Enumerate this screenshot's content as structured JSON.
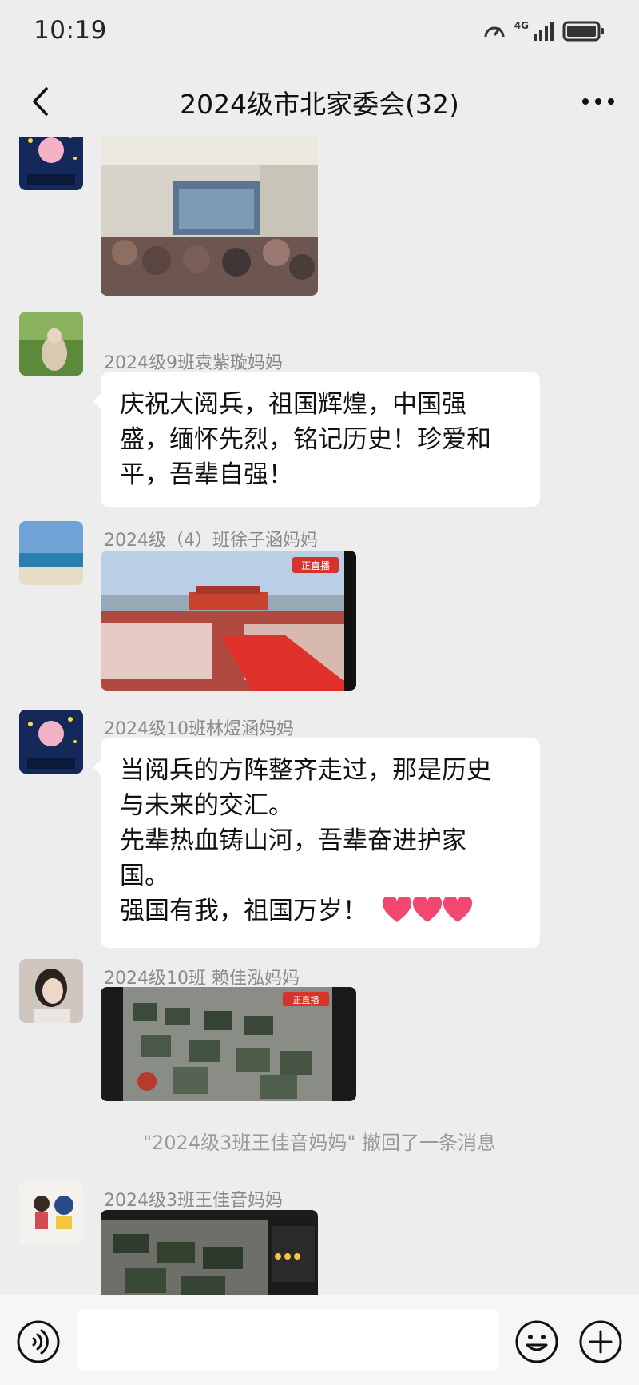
{
  "status": {
    "time": "10:19",
    "network": "4G"
  },
  "nav": {
    "title": "2024级市北家委会(32)"
  },
  "messages": [
    {
      "sender": "2024级9班袁紫璇妈妈",
      "lines": [
        "庆祝大阅兵，祖国辉煌，中国强",
        "盛，缅怀先烈，铭记历史！珍爱和",
        "平，吾辈自强！"
      ]
    },
    {
      "sender": "2024级（4）班徐子涵妈妈",
      "photo_badge": "正直播"
    },
    {
      "sender": "2024级10班林煜涵妈妈",
      "lines": [
        "当阅兵的方阵整齐走过，那是历史",
        "与未来的交汇。",
        "先辈热血铸山河，吾辈奋进护家",
        "国。",
        "强国有我，祖国万岁！"
      ],
      "hearts": 3
    },
    {
      "sender": "2024级10班 赖佳泓妈妈",
      "photo_badge": "正直播"
    },
    {
      "sender": "2024级3班王佳音妈妈"
    }
  ],
  "system_notice": "\"2024级3班王佳音妈妈\" 撤回了一条消息",
  "input": {
    "placeholder": ""
  },
  "icons": [
    "back-icon",
    "more-icon",
    "voice-icon",
    "emoji-icon",
    "plus-icon",
    "signal-icon",
    "battery-icon",
    "speed-icon",
    "heart-icon"
  ],
  "colors": {
    "background": "#ededed",
    "bubble": "#ffffff",
    "sender": "#8a8a8a",
    "heart": "#f0486e"
  }
}
